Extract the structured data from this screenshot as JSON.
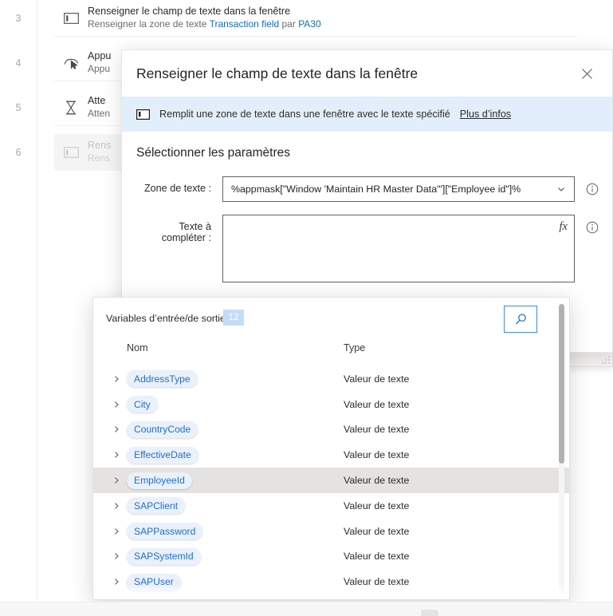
{
  "background": {
    "steps": [
      {
        "number": "3",
        "icon": "textbox-icon",
        "title": "Renseigner le champ de texte dans la fenêtre",
        "sub_prefix": "Renseigner la zone de texte ",
        "sub_link1": "Transaction field",
        "sub_mid": " par ",
        "sub_link2": "PA30",
        "selected": false
      },
      {
        "number": "4",
        "icon": "cursor-click-icon",
        "title": "Appu",
        "sub_prefix": "Appu",
        "sub_link1": "",
        "sub_mid": "",
        "sub_link2": "",
        "selected": false
      },
      {
        "number": "5",
        "icon": "hourglass-icon",
        "title": "Atte",
        "sub_prefix": "Atten",
        "sub_link1": "",
        "sub_mid": "",
        "sub_link2": "",
        "selected": false
      },
      {
        "number": "6",
        "icon": "textbox-icon",
        "title": "Rens",
        "sub_prefix": "Rens",
        "sub_link1": "",
        "sub_mid": "",
        "sub_link2": "",
        "selected": true
      }
    ]
  },
  "modal": {
    "title": "Renseigner le champ de texte dans la fenêtre",
    "close_icon": "close-icon",
    "banner": {
      "icon": "textbox-icon",
      "text": "Remplit une zone de texte dans une fenêtre avec le texte spécifié",
      "link": "Plus d’infos"
    },
    "params_heading": "Sélectionner les paramètres",
    "fields": [
      {
        "label": "Zone de texte :",
        "value": "%appmask[\"Window 'Maintain HR Master Data'\"][\"Employee id\"]%",
        "type": "select",
        "chevron_icon": "chevron-down-icon",
        "info_icon": "info-icon"
      },
      {
        "label": "Texte à compléter :",
        "value": "",
        "placeholder": "",
        "type": "textarea",
        "fx_icon": "fx-icon",
        "info_icon": "info-icon"
      }
    ]
  },
  "variables_panel": {
    "title": "Variables d’entrée/de sortie",
    "count": "12",
    "search_icon": "search-icon",
    "columns": {
      "name": "Nom",
      "type": "Type"
    },
    "expand_icon": "chevron-right-icon",
    "rows": [
      {
        "name": "AddressType",
        "type": "Valeur de texte",
        "highlighted": false
      },
      {
        "name": "City",
        "type": "Valeur de texte",
        "highlighted": false
      },
      {
        "name": "CountryCode",
        "type": "Valeur de texte",
        "highlighted": false
      },
      {
        "name": "EffectiveDate",
        "type": "Valeur de texte",
        "highlighted": false
      },
      {
        "name": "EmployeeId",
        "type": "Valeur de texte",
        "highlighted": true
      },
      {
        "name": "SAPClient",
        "type": "Valeur de texte",
        "highlighted": false
      },
      {
        "name": "SAPPassword",
        "type": "Valeur de texte",
        "highlighted": false
      },
      {
        "name": "SAPSystemId",
        "type": "Valeur de texte",
        "highlighted": false
      },
      {
        "name": "SAPUser",
        "type": "Valeur de texte",
        "highlighted": false
      }
    ]
  },
  "colors": {
    "accent_blue": "#0f6cbd",
    "banner_bg": "#e3eefc",
    "pill_bg": "#eaf1fb",
    "pill_text": "#1f6fd0",
    "badge_bg": "#c5dcf8",
    "row_highlight": "#e5e3e1"
  }
}
